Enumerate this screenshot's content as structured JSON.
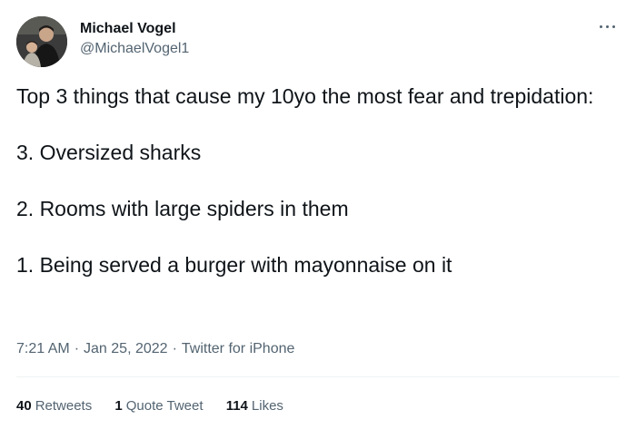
{
  "author": {
    "display_name": "Michael Vogel",
    "handle": "@MichaelVogel1",
    "avatar_icon": "avatar-photo"
  },
  "more_icon": "more-horizontal-icon",
  "tweet": {
    "lines": [
      "Top 3 things that cause my 10yo the most fear and trepidation:",
      "3. Oversized sharks",
      "2. Rooms with large spiders in them",
      "1. Being served a burger with mayonnaise on it"
    ]
  },
  "meta": {
    "time": "7:21 AM",
    "separator": "·",
    "date": "Jan 25, 2022",
    "source": "Twitter for iPhone"
  },
  "stats": {
    "retweets_count": "40",
    "retweets_label": "Retweets",
    "quotes_count": "1",
    "quotes_label": "Quote Tweet",
    "likes_count": "114",
    "likes_label": "Likes"
  },
  "colors": {
    "text_primary": "#0f1419",
    "text_secondary": "#536471",
    "divider": "#eff3f4"
  }
}
